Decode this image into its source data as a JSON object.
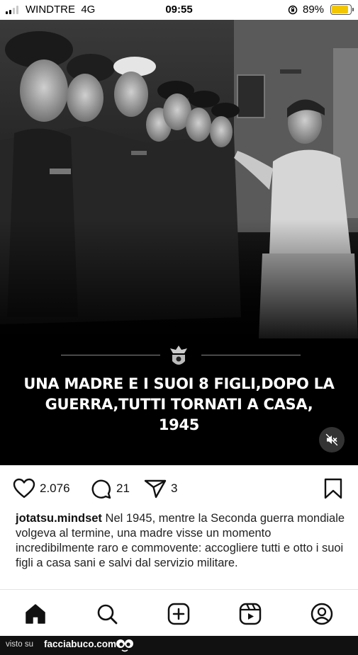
{
  "status_bar": {
    "carrier": "WINDTRE",
    "network": "4G",
    "time": "09:55",
    "battery": "89%",
    "battery_level": 0.89,
    "battery_color": "#f2c600"
  },
  "post": {
    "overlay_caption_line1": "UNA MADRE E I SUOI 8 FIGLI,DOPO LA",
    "overlay_caption_line2": "GUERRA,TUTTI TORNATI A CASA,",
    "overlay_caption_line3": "1945",
    "mute_icon": "speaker-muted-icon"
  },
  "actions": {
    "likes": "2.076",
    "comments": "21",
    "shares": "3"
  },
  "caption": {
    "username": "jotatsu.mindset",
    "text": "Nel 1945, mentre la Seconda guerra mondiale volgeva al termine, una madre visse un momento incredibilmente raro e commovente: accogliere tutti e otto i suoi figli a casa sani e salvi dal servizio militare."
  },
  "nav": {
    "items": [
      "home-icon",
      "search-icon",
      "create-icon",
      "reels-icon",
      "profile-icon"
    ]
  },
  "watermark": {
    "prefix": "visto su",
    "site": "facciabuco.com"
  }
}
